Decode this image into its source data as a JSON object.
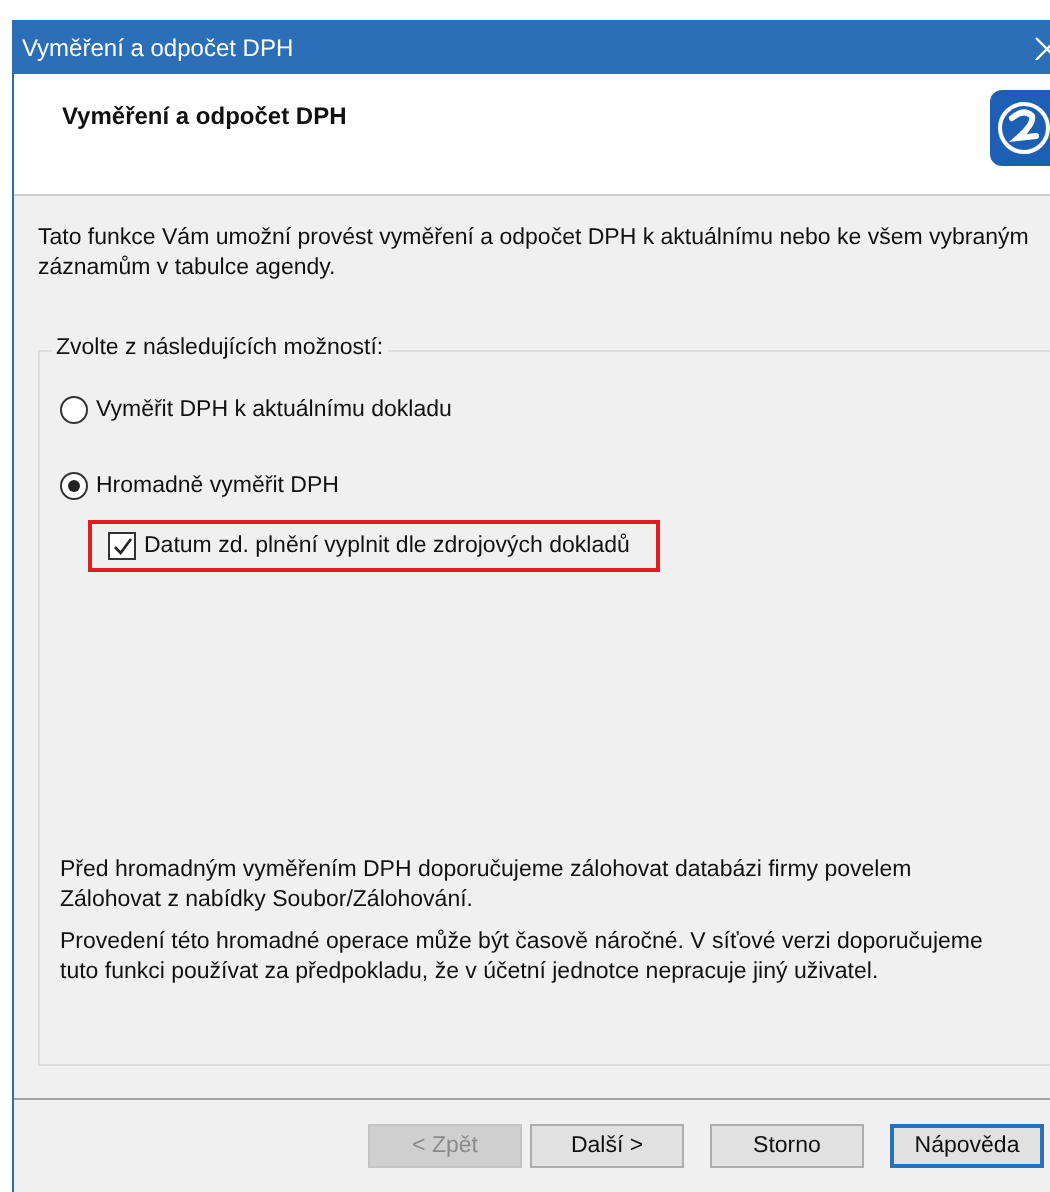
{
  "window": {
    "title": "Vyměření a odpočet DPH"
  },
  "header": {
    "title": "Vyměření a odpočet DPH"
  },
  "intro": "Tato funkce Vám umožní provést vyměření a odpočet DPH k aktuálnímu nebo ke všem vybraným záznamům v tabulce agendy.",
  "options": {
    "legend": "Zvolte z následujících možností:",
    "radios": [
      {
        "label": "Vyměřit DPH k aktuálnímu dokladu",
        "selected": false
      },
      {
        "label": "Hromadně vyměřit DPH",
        "selected": true
      }
    ],
    "checkbox": {
      "label": "Datum zd. plnění vyplnit dle zdrojových dokladů",
      "checked": true,
      "highlighted": true
    },
    "notes": [
      "Před hromadným vyměřením DPH doporučujeme zálohovat databázi firmy povelem Zálohovat z nabídky Soubor/Zálohování.",
      "Provedení této hromadné operace může být časově náročné. V síťové verzi doporučujeme tuto funkci používat za předpokladu, že v účetní jednotce nepracuje jiný uživatel."
    ]
  },
  "buttons": [
    {
      "label": "< Zpět",
      "disabled": true,
      "default": false
    },
    {
      "label": "Další >",
      "disabled": false,
      "default": false
    },
    {
      "label": "Storno",
      "disabled": false,
      "default": false
    },
    {
      "label": "Nápověda",
      "disabled": false,
      "default": true
    }
  ]
}
